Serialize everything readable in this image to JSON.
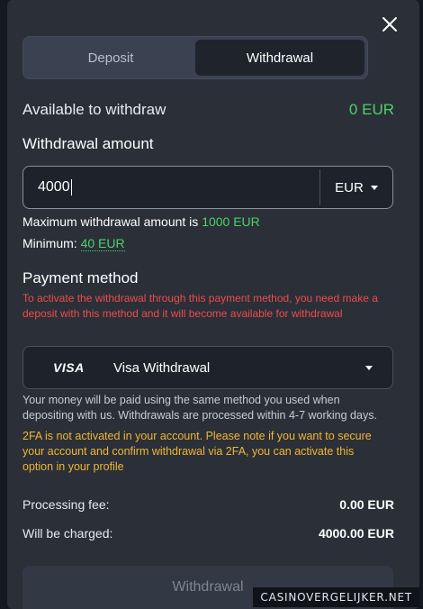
{
  "tabs": [
    {
      "label": "Deposit",
      "active": false
    },
    {
      "label": "Withdrawal",
      "active": true
    }
  ],
  "available": {
    "label": "Available to withdraw",
    "value": "0 EUR"
  },
  "amount": {
    "label": "Withdrawal amount",
    "value": "4000",
    "currency": "EUR",
    "max_prefix": "Maximum withdrawal amount is",
    "max_value": "1000 EUR",
    "min_prefix": "Minimum:",
    "min_value": "40 EUR"
  },
  "payment": {
    "label": "Payment method",
    "warning": "To activate the withdrawal through this payment method, you need make a deposit with this method and it will become available for withdrawal",
    "logo_text": "VISA",
    "selected": "Visa Withdrawal",
    "info": "Your money will be paid using the same method you used when depositing with us. Withdrawals are processed within 4-7 working days.",
    "twofa_warning": "2FA is not activated in your account. Please note if you want to secure your account and confirm withdrawal via 2FA, you can activate this option in your profile"
  },
  "summary": {
    "fee_label": "Processing fee:",
    "fee_value": "0.00 EUR",
    "charge_label": "Will be charged:",
    "charge_value": "4000.00 EUR"
  },
  "submit_label": "Withdrawal",
  "watermark": "CASINOVERGELIJKER.NET",
  "colors": {
    "accent_green": "#4fd16a",
    "warning_red": "#ef4b4b",
    "warning_yellow": "#f2b632",
    "modal_bg": "#2a2f38"
  },
  "icons": {
    "close": "close-icon",
    "dropdown": "chevron-down-icon"
  }
}
